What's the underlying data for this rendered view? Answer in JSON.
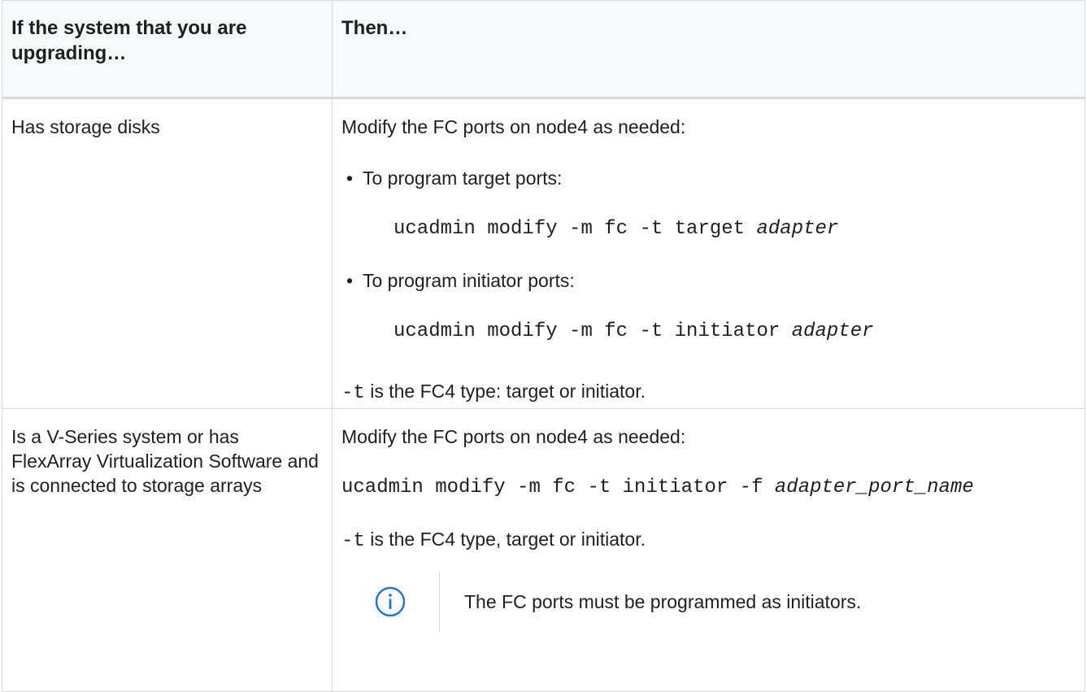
{
  "header": {
    "col1": "If the system that you are upgrading…",
    "col2": "Then…"
  },
  "rows": [
    {
      "condition": "Has storage disks",
      "intro": "Modify the FC ports on node4 as needed:",
      "bullets": [
        {
          "label": "To program target ports:",
          "command": "ucadmin modify -m fc -t target",
          "command_arg": "adapter"
        },
        {
          "label": "To program initiator ports:",
          "command": "ucadmin modify -m fc -t initiator",
          "command_arg": "adapter"
        }
      ],
      "footnote_code": "-t",
      "footnote_text": " is the FC4 type: target or initiator."
    },
    {
      "condition": "Is a V-Series system or has FlexArray Virtualization Software and is connected to storage arrays",
      "intro": "Modify the FC ports on node4 as needed:",
      "command": "ucadmin modify -m fc -t initiator -f",
      "command_arg": "adapter_port_name",
      "footnote_code": "-t",
      "footnote_text": " is the FC4 type, target or initiator.",
      "note_icon": "info-icon",
      "note_text": "The FC ports must be programmed as initiators.",
      "accent_color": "#1a73e8"
    }
  ]
}
